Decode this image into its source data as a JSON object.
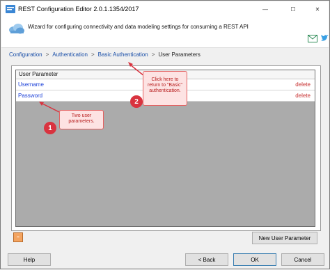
{
  "window": {
    "title": "REST Configuration Editor 2.0.1.1354/2017",
    "controls": {
      "minimize": "—",
      "maximize": "☐",
      "close": "✕"
    }
  },
  "header": {
    "description": "Wizard for configuring connectivity and data modeling settings for consuming a REST API",
    "icons": [
      "cloud-icon",
      "mail-icon",
      "twitter-bird-icon"
    ]
  },
  "breadcrumb": {
    "items": [
      "Configuration",
      "Authentication",
      "Basic Authentication"
    ],
    "separator": ">",
    "current": "User Parameters"
  },
  "grid": {
    "column_header": "User Parameter",
    "rows": [
      {
        "name": "Username",
        "action": "delete"
      },
      {
        "name": "Password",
        "action": "delete"
      }
    ]
  },
  "annotations": [
    {
      "number": "1",
      "text": "Two user parameters."
    },
    {
      "number": "2",
      "text": "Click here to return to \"Basic\" authentication."
    }
  ],
  "buttons": {
    "new_parameter": "New User Parameter",
    "help": "Help",
    "back": "< Back",
    "ok": "OK",
    "cancel": "Cancel"
  },
  "colors": {
    "link": "#1a4fa8",
    "delete": "#c83232",
    "annotation": "#d9333f",
    "grid_background": "#ababab"
  }
}
